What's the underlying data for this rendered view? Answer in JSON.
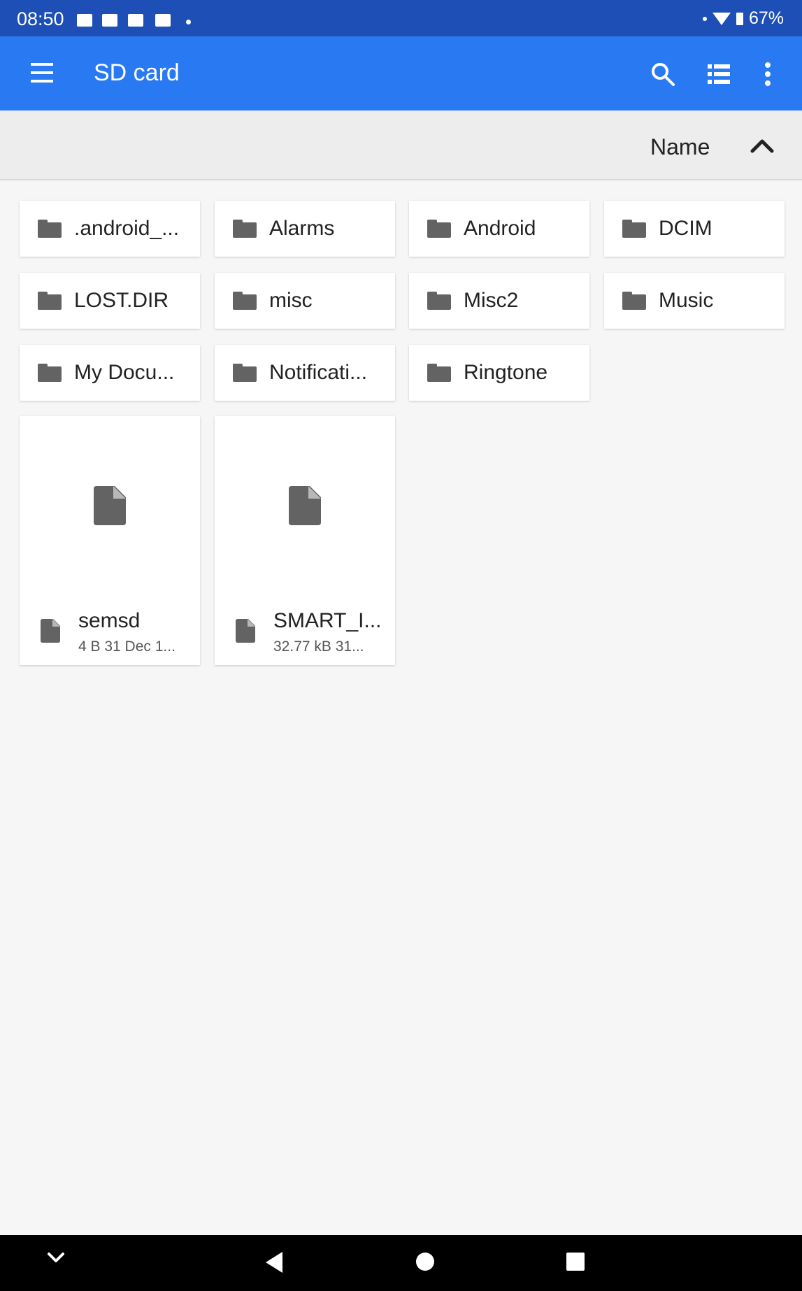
{
  "status_bar": {
    "time": "08:50",
    "battery": "67%",
    "notification_icons": [
      "calendar-icon",
      "photo-icon",
      "mail-icon",
      "card-icon"
    ]
  },
  "app_bar": {
    "title": "SD card",
    "icons": [
      "menu-icon",
      "search-icon",
      "list-view-icon",
      "more-vert-icon"
    ],
    "color": "#2979f2"
  },
  "sort_bar": {
    "label": "Name",
    "direction_icon": "chevron-up-icon"
  },
  "folders": [
    {
      "name": ".android_..."
    },
    {
      "name": "Alarms"
    },
    {
      "name": "Android"
    },
    {
      "name": "DCIM"
    },
    {
      "name": "LOST.DIR"
    },
    {
      "name": "misc"
    },
    {
      "name": "Misc2"
    },
    {
      "name": "Music"
    },
    {
      "name": "My Docu..."
    },
    {
      "name": "Notificati..."
    },
    {
      "name": "Ringtone"
    }
  ],
  "files": [
    {
      "name": "semsd",
      "meta": "4 B 31 Dec 1..."
    },
    {
      "name": "SMART_I...",
      "meta": "32.77 kB 31..."
    }
  ],
  "nav_bar": {
    "icons": [
      "chevron-down-icon",
      "back-icon",
      "home-icon",
      "recents-icon"
    ]
  }
}
